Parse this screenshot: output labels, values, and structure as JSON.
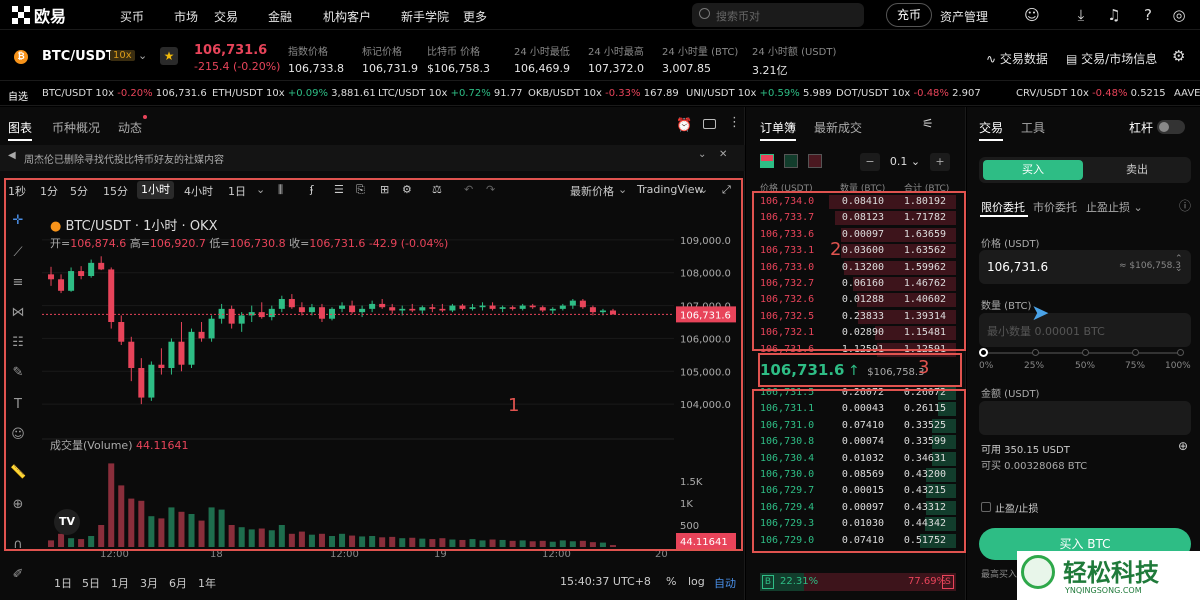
{
  "brand": {
    "name": "欧易"
  },
  "nav": {
    "items": [
      "买币",
      "市场",
      "交易",
      "金融",
      "机构客户",
      "新手学院",
      "更多"
    ],
    "search_placeholder": "搜索币对",
    "deposit": "充币",
    "asset_mgmt": "资产管理"
  },
  "ticker": {
    "pair": "BTC/USDT",
    "leverage": "10x",
    "price": "106,731.6",
    "change": "-215.4 (-0.20%)",
    "stats": [
      {
        "label": "指数价格",
        "value": "106,733.8"
      },
      {
        "label": "标记价格",
        "value": "106,731.9"
      },
      {
        "label": "比特币 价格",
        "value": "$106,758.3"
      },
      {
        "label": "24 小时最低",
        "value": "106,469.9"
      },
      {
        "label": "24 小时最高",
        "value": "107,372.0"
      },
      {
        "label": "24 小时量 (BTC)",
        "value": "3,007.85"
      },
      {
        "label": "24 小时额 (USDT)",
        "value": "3.21亿"
      }
    ],
    "links": [
      "交易数据",
      "交易/市场信息"
    ]
  },
  "watchlist": {
    "label": "自选",
    "items": [
      {
        "pair": "BTC/USDT 10x",
        "chg": "-0.20%",
        "price": "106,731.6",
        "dir": "dn"
      },
      {
        "pair": "ETH/USDT 10x",
        "chg": "+0.09%",
        "price": "3,881.61",
        "dir": "up"
      },
      {
        "pair": "LTC/USDT 10x",
        "chg": "+0.72%",
        "price": "91.77",
        "dir": "up"
      },
      {
        "pair": "OKB/USDT 10x",
        "chg": "-0.33%",
        "price": "167.89",
        "dir": "dn"
      },
      {
        "pair": "UNI/USDT 10x",
        "chg": "+0.59%",
        "price": "5.989",
        "dir": "up"
      },
      {
        "pair": "DOT/USDT 10x",
        "chg": "-0.48%",
        "price": "2.907",
        "dir": "dn"
      },
      {
        "pair": "CRV/USDT 10x",
        "chg": "-0.48%",
        "price": "0.5215",
        "dir": "dn"
      },
      {
        "pair": "AAVE/U",
        "chg": "",
        "price": "",
        "dir": "up"
      }
    ]
  },
  "chartpanel": {
    "tabs": [
      "图表",
      "币种概况",
      "动态"
    ],
    "notice": "周杰伦已删除寻找代投比特币好友的社媒内容",
    "timeframes": [
      "1秒",
      "1分",
      "5分",
      "15分",
      "1小时",
      "4小时",
      "1日"
    ],
    "active_tf": "1小时",
    "price_type": "最新价格",
    "view": "TradingView",
    "title": "BTC/USDT · 1小时 · OKX",
    "ohlc": {
      "open_l": "开=",
      "open": "106,874.6",
      "high_l": "高=",
      "high": "106,920.7",
      "low_l": "低=",
      "low": "106,730.8",
      "close_l": "收=",
      "close": "106,731.6",
      "chg": "-42.9 (-0.04%)"
    },
    "volume_label": "成交量(Volume)",
    "volume_value": "44.11641",
    "bottom": {
      "ranges": [
        "1日",
        "5日",
        "1月",
        "3月",
        "6月",
        "1年"
      ],
      "time": "15:40:37 UTC+8",
      "pct": "%",
      "log": "log",
      "auto": "自动"
    },
    "annot": "1"
  },
  "chart_data": {
    "type": "candlestick",
    "title": "BTC/USDT · 1小时 · OKX",
    "ylim": [
      103000,
      110000
    ],
    "yticks": [
      104000,
      105000,
      106000,
      107000,
      108000,
      109000
    ],
    "ytick_labels": [
      "104,000.0",
      "105,000.0",
      "106,000.0",
      "107,000.0",
      "108,000.0",
      "109,000.0"
    ],
    "last_price": "106,731.6",
    "last_price_value": 106731.6,
    "xtick_labels": [
      "12:00",
      "18",
      "12:00",
      "19",
      "12:00",
      "20"
    ],
    "vol_ylim": [
      0,
      2000
    ],
    "vol_ticks": [
      "1.5K",
      "1K",
      "500"
    ],
    "last_volume": "44.11641",
    "candles": [
      [
        107950,
        108180,
        107600,
        107800
      ],
      [
        107800,
        107950,
        107380,
        107450
      ],
      [
        107450,
        108160,
        107420,
        108050
      ],
      [
        108050,
        108200,
        107800,
        107900
      ],
      [
        107900,
        108400,
        107850,
        108300
      ],
      [
        108300,
        108500,
        108080,
        108100
      ],
      [
        108100,
        108160,
        106300,
        106500
      ],
      [
        106500,
        106700,
        105800,
        105900
      ],
      [
        105900,
        106050,
        104700,
        105100
      ],
      [
        105100,
        105400,
        104000,
        104200
      ],
      [
        104200,
        105300,
        104100,
        105200
      ],
      [
        105200,
        105700,
        104900,
        105100
      ],
      [
        105100,
        106000,
        104900,
        105900
      ],
      [
        105900,
        106500,
        105000,
        105200
      ],
      [
        105200,
        106300,
        105100,
        106200
      ],
      [
        106200,
        106500,
        105900,
        106000
      ],
      [
        106000,
        106700,
        105900,
        106600
      ],
      [
        106600,
        107050,
        106450,
        106900
      ],
      [
        106900,
        107000,
        106300,
        106450
      ],
      [
        106450,
        106800,
        106200,
        106700
      ],
      [
        106700,
        107000,
        106500,
        106800
      ],
      [
        106800,
        107100,
        106600,
        106650
      ],
      [
        106650,
        107000,
        106550,
        106900
      ],
      [
        106900,
        107300,
        106800,
        107200
      ],
      [
        107200,
        107350,
        106900,
        106950
      ],
      [
        106950,
        107100,
        106700,
        106800
      ],
      [
        106800,
        107050,
        106700,
        106950
      ],
      [
        106950,
        107050,
        106500,
        106600
      ],
      [
        106600,
        106950,
        106550,
        106900
      ],
      [
        106900,
        107100,
        106800,
        107000
      ],
      [
        107000,
        107150,
        106750,
        106800
      ],
      [
        106800,
        107000,
        106650,
        106900
      ],
      [
        106900,
        107150,
        106800,
        107050
      ],
      [
        107050,
        107200,
        106900,
        106950
      ],
      [
        106950,
        107050,
        106750,
        106850
      ],
      [
        106850,
        107000,
        106700,
        106900
      ],
      [
        106900,
        107050,
        106800,
        106850
      ],
      [
        106850,
        107000,
        106750,
        106950
      ],
      [
        106950,
        107050,
        106800,
        106900
      ],
      [
        106900,
        107050,
        106800,
        106850
      ],
      [
        106850,
        107050,
        106800,
        107000
      ],
      [
        107000,
        107050,
        106850,
        106900
      ],
      [
        106900,
        107050,
        106850,
        106950
      ],
      [
        106950,
        107100,
        106850,
        107000
      ],
      [
        107000,
        107100,
        106850,
        106900
      ],
      [
        106900,
        107000,
        106800,
        106950
      ],
      [
        106950,
        107000,
        106850,
        106900
      ],
      [
        106900,
        107050,
        106850,
        107000
      ],
      [
        107000,
        107050,
        106900,
        106950
      ],
      [
        106950,
        107000,
        106800,
        106850
      ],
      [
        106850,
        106950,
        106750,
        106900
      ],
      [
        106900,
        107050,
        106850,
        107000
      ],
      [
        107000,
        107200,
        106900,
        107150
      ],
      [
        107150,
        107200,
        106900,
        106950
      ],
      [
        106950,
        107000,
        106700,
        106800
      ],
      [
        106800,
        106900,
        106700,
        106850
      ],
      [
        106850,
        106900,
        106730,
        106731.6
      ]
    ],
    "volumes": [
      150,
      300,
      200,
      180,
      250,
      500,
      1900,
      1400,
      1100,
      1050,
      700,
      650,
      900,
      800,
      750,
      600,
      900,
      850,
      500,
      450,
      400,
      420,
      380,
      500,
      300,
      350,
      280,
      300,
      250,
      300,
      260,
      240,
      250,
      220,
      230,
      200,
      210,
      190,
      180,
      200,
      170,
      160,
      180,
      150,
      170,
      160,
      140,
      150,
      130,
      140,
      120,
      150,
      130,
      140,
      110,
      100,
      44
    ]
  },
  "orderbook": {
    "tabs": [
      "订单簿",
      "最新成交"
    ],
    "step": "0.1",
    "headers": [
      "价格 (USDT)",
      "数量 (BTC)",
      "合计 (BTC)"
    ],
    "asks": [
      [
        "106,734.0",
        "0.08410",
        "1.80192",
        1.80192
      ],
      [
        "106,733.7",
        "0.08123",
        "1.71782",
        1.71782
      ],
      [
        "106,733.6",
        "0.00097",
        "1.63659",
        1.63659
      ],
      [
        "106,733.1",
        "0.03600",
        "1.63562",
        1.63562
      ],
      [
        "106,733.0",
        "0.13200",
        "1.59962",
        1.59962
      ],
      [
        "106,732.7",
        "0.06160",
        "1.46762",
        1.46762
      ],
      [
        "106,732.6",
        "0.01288",
        "1.40602",
        1.40602
      ],
      [
        "106,732.5",
        "0.23833",
        "1.39314",
        1.39314
      ],
      [
        "106,732.1",
        "0.02890",
        "1.15481",
        1.15481
      ],
      [
        "106,731.6",
        "1.12591",
        "1.12591",
        1.12591
      ]
    ],
    "mid_price": "106,731.6",
    "mid_arrow": "↑",
    "mid_usd": "$106,758.3",
    "bids": [
      [
        "106,731.5",
        "0.26072",
        "0.26072",
        0.26072
      ],
      [
        "106,731.1",
        "0.00043",
        "0.26115",
        0.26115
      ],
      [
        "106,731.0",
        "0.07410",
        "0.33525",
        0.33525
      ],
      [
        "106,730.8",
        "0.00074",
        "0.33599",
        0.33599
      ],
      [
        "106,730.4",
        "0.01032",
        "0.34631",
        0.34631
      ],
      [
        "106,730.0",
        "0.08569",
        "0.43200",
        0.432
      ],
      [
        "106,729.7",
        "0.00015",
        "0.43215",
        0.43215
      ],
      [
        "106,729.4",
        "0.00097",
        "0.43312",
        0.43312
      ],
      [
        "106,729.3",
        "0.01030",
        "0.44342",
        0.44342
      ],
      [
        "106,729.0",
        "0.07410",
        "0.51752",
        0.51752
      ]
    ],
    "buy_pct": "22.31%",
    "sell_pct": "77.69%",
    "buy_label": "B",
    "sell_label": "S",
    "annot2": "2",
    "annot3": "3"
  },
  "trade": {
    "tabs": [
      "交易",
      "工具"
    ],
    "leverage_label": "杠杆",
    "buy": "买入",
    "sell": "卖出",
    "order_types": [
      "限价委托",
      "市价委托",
      "止盈止损"
    ],
    "price_label": "价格 (USDT)",
    "price_value": "106,731.6",
    "price_usd": "≈ $106,758.3",
    "qty_label": "数量 (BTC)",
    "qty_placeholder": "最小数量 0.00001 BTC",
    "pcts": [
      "0%",
      "25%",
      "50%",
      "75%",
      "100%"
    ],
    "amount_label": "金额 (USDT)",
    "avail": "可用 350.15 USDT",
    "can_buy": "可买 0.00328068 BTC",
    "tpsl": "止盈/止损",
    "submit": "买入 BTC",
    "more": "最高买入"
  },
  "watermark": {
    "name": "轻松科技",
    "url": "YNQINGSONG.COM"
  },
  "colors": {
    "up": "#2ebd85",
    "down": "#e8445a",
    "annot": "#e0534f"
  }
}
